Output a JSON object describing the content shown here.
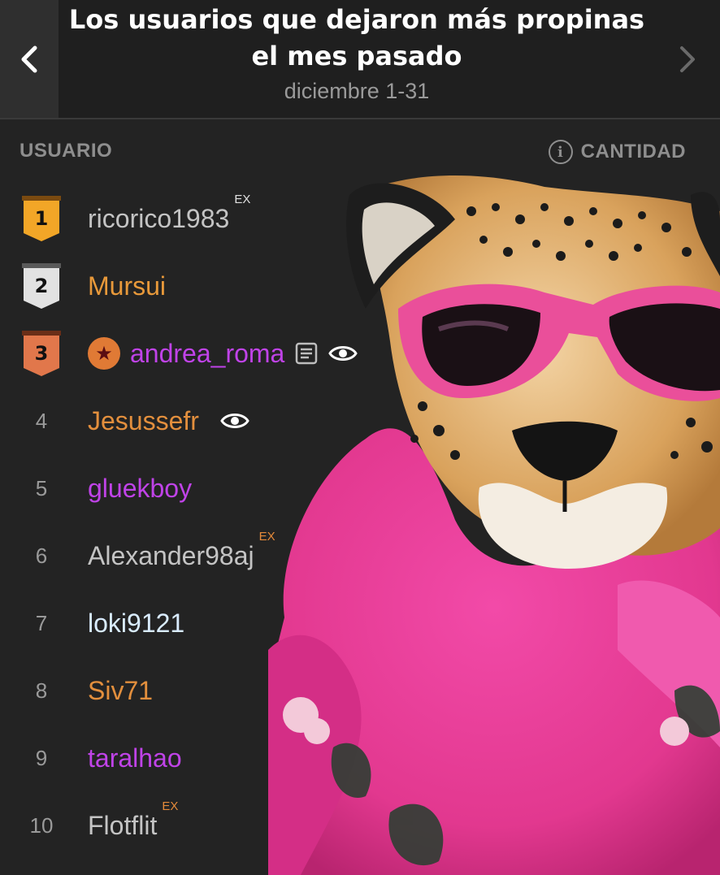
{
  "header": {
    "title": "Los usuarios que dejaron más propinas el mes pasado",
    "date_range": "diciembre 1-31"
  },
  "columns": {
    "user": "USUARIO",
    "amount": "CANTIDAD"
  },
  "rows": [
    {
      "rank": "1",
      "name": "ricorico1983",
      "color": "#c4c4c4",
      "ex": "EX",
      "medal": "gold"
    },
    {
      "rank": "2",
      "name": "Mursui",
      "color": "#e8993a",
      "medal": "silver"
    },
    {
      "rank": "3",
      "name": "andrea_roma",
      "color": "#c043e8",
      "medal": "bronze"
    },
    {
      "rank": "4",
      "name": "Jesussefr",
      "color": "#e38f3d"
    },
    {
      "rank": "5",
      "name": "gluekboy",
      "color": "#c043e8"
    },
    {
      "rank": "6",
      "name": "Alexander98aj",
      "color": "#c4c4c4",
      "ex": "EX"
    },
    {
      "rank": "7",
      "name": "loki9121",
      "color": "#d9ecff"
    },
    {
      "rank": "8",
      "name": "Siv71",
      "color": "#e38f3d"
    },
    {
      "rank": "9",
      "name": "taralhao",
      "color": "#c043e8"
    },
    {
      "rank": "10",
      "name": "Flotflit",
      "color": "#c4c4c4",
      "ex": "EX"
    }
  ]
}
